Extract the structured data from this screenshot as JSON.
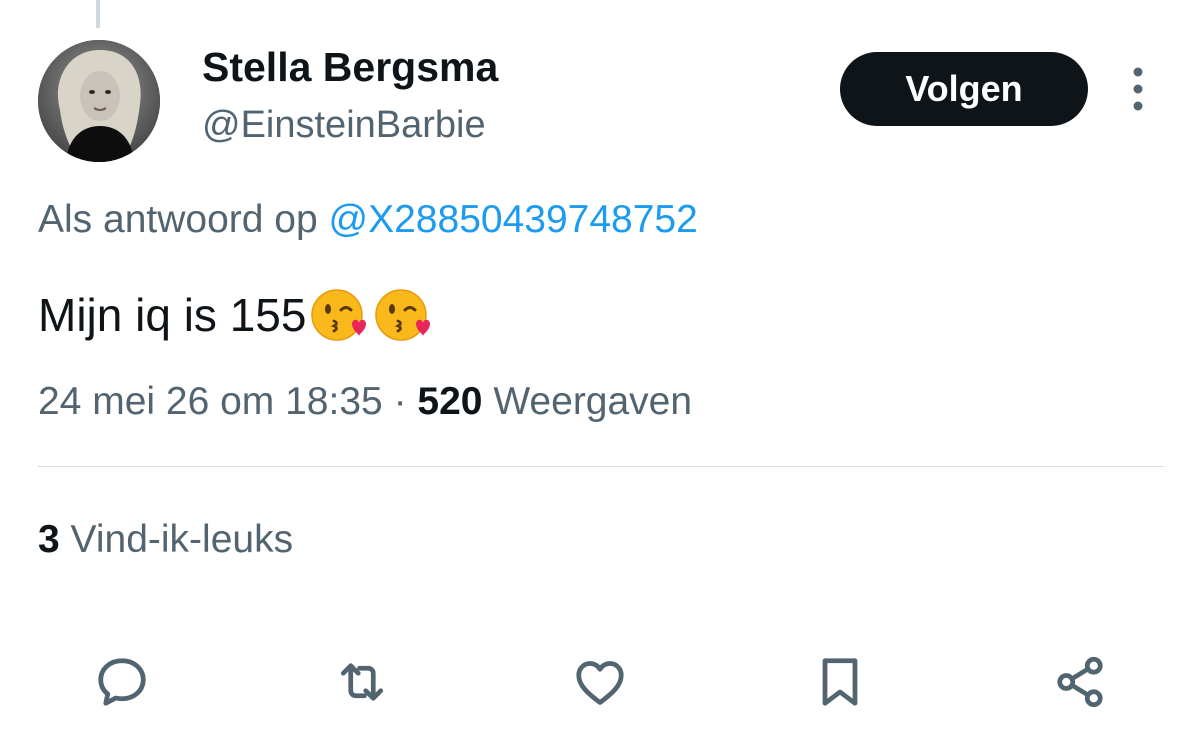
{
  "tweet": {
    "display_name": "Stella Bergsma",
    "handle": "@EinsteinBarbie",
    "follow_label": "Volgen",
    "reply_prefix": "Als antwoord op",
    "reply_to": "@X28850439748752",
    "text": "Mijn iq is 155",
    "emojis": [
      "kiss-heart-emoji",
      "kiss-heart-emoji"
    ],
    "timestamp": "24 mei 26 om 18:35",
    "separator": "·",
    "views_count": "520",
    "views_label": "Weergaven",
    "likes_count": "3",
    "likes_label": "Vind-ik-leuks"
  },
  "actions": [
    {
      "name": "reply",
      "icon": "speech-bubble-icon"
    },
    {
      "name": "retweet",
      "icon": "retweet-arrows-icon"
    },
    {
      "name": "like",
      "icon": "heart-icon"
    },
    {
      "name": "bookmark",
      "icon": "bookmark-icon"
    },
    {
      "name": "share",
      "icon": "share-nodes-icon"
    }
  ],
  "colors": {
    "text_primary": "#0f1419",
    "text_secondary": "#536471",
    "link": "#1d9bf0",
    "button_bg": "#0f1419",
    "divider": "#d9e0e4"
  }
}
